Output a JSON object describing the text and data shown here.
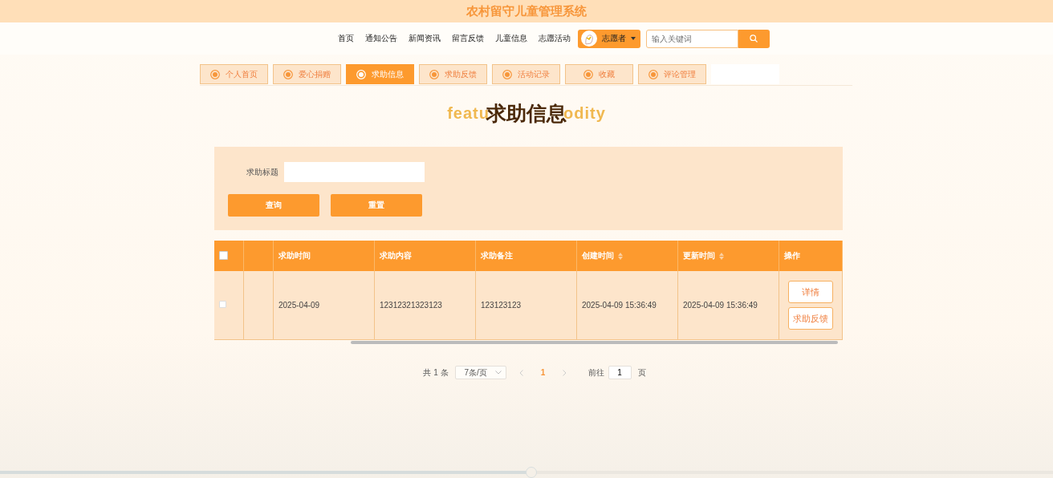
{
  "site_title": "农村留守儿童管理系统",
  "nav": {
    "items": [
      "首页",
      "通知公告",
      "新闻资讯",
      "留言反馈",
      "儿童信息",
      "志愿活动"
    ],
    "user_menu": {
      "label": "志愿者"
    },
    "search": {
      "placeholder": "输入关键词"
    }
  },
  "tabs": [
    {
      "label": "个人首页",
      "selected": false
    },
    {
      "label": "爱心捐赠",
      "selected": false
    },
    {
      "label": "求助信息",
      "selected": true
    },
    {
      "label": "求助反馈",
      "selected": false
    },
    {
      "label": "活动记录",
      "selected": false
    },
    {
      "label": "收藏",
      "selected": false
    },
    {
      "label": "评论管理",
      "selected": false
    }
  ],
  "heading": {
    "title": "求助信息",
    "backdrop_left": "featu",
    "backdrop_right": "odity"
  },
  "filter": {
    "label": "求助标题",
    "buttons": [
      "查询",
      "重置"
    ]
  },
  "table": {
    "columns": [
      {
        "label": "求助时间",
        "sortable": false
      },
      {
        "label": "求助内容",
        "sortable": false
      },
      {
        "label": "求助备注",
        "sortable": false
      },
      {
        "label": "创建时间",
        "sortable": true
      },
      {
        "label": "更新时间",
        "sortable": true
      },
      {
        "label": "操作",
        "sortable": false
      }
    ],
    "all_checked": false,
    "rows": [
      {
        "checked": false,
        "cells": [
          "2025-04-09",
          "12312321323123",
          "123123123",
          "2025-04-09 15:36:49",
          "2025-04-09 15:36:49"
        ],
        "actions": [
          "详情",
          "求助反馈"
        ]
      }
    ]
  },
  "pagination": {
    "total": "共 1 条",
    "page_size": "7条/页",
    "pages": [
      {
        "label": "1",
        "selected": true
      }
    ],
    "goto_label": "前往",
    "goto_value": "1",
    "goto_unit": "页"
  },
  "player_progress": {
    "level": 0.5
  }
}
